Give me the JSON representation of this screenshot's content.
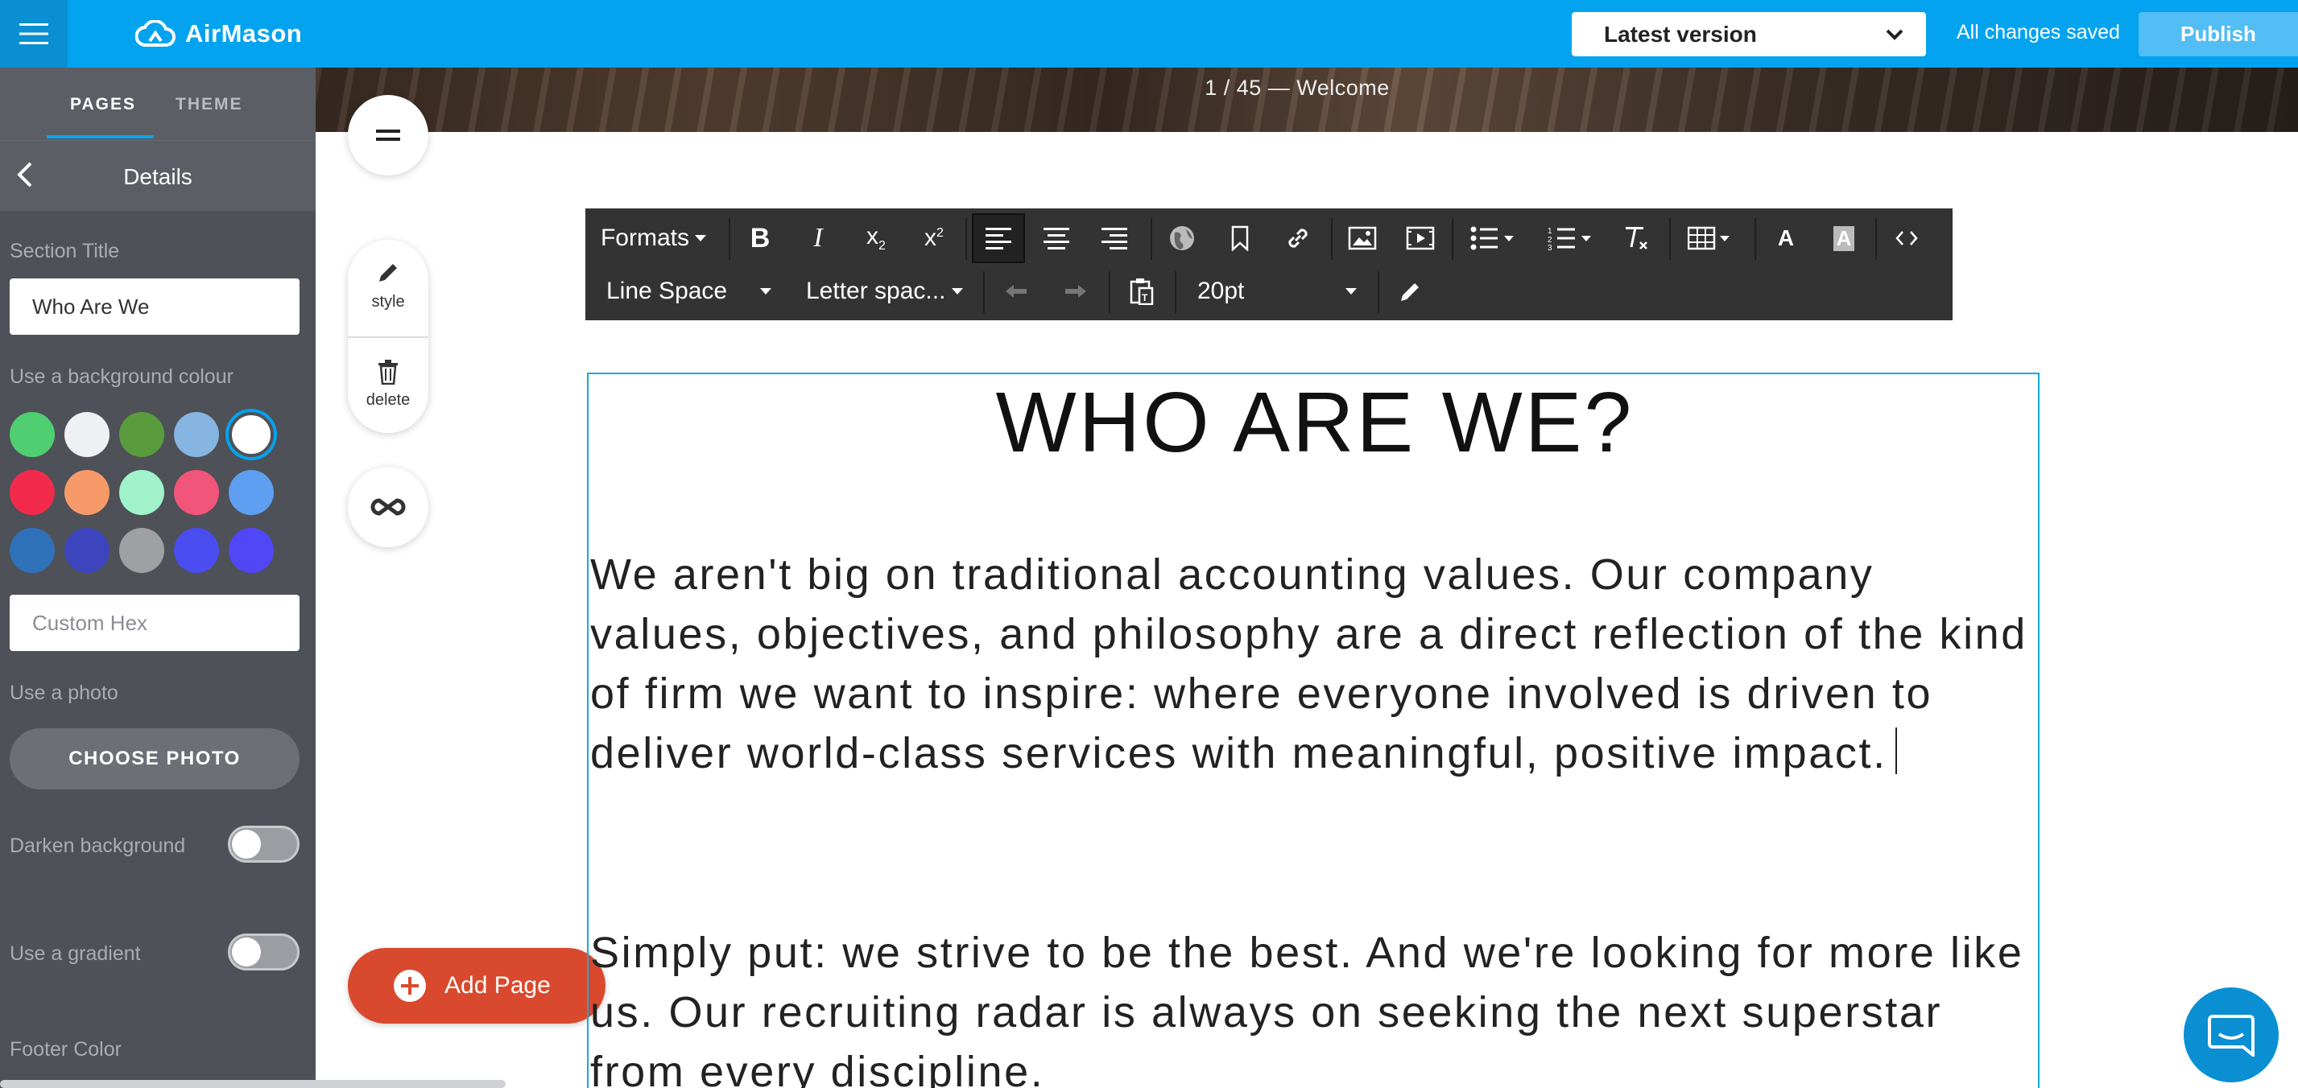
{
  "app": {
    "brand": "AirMason"
  },
  "header": {
    "version_label": "Latest version",
    "status": "All changes saved",
    "publish_label": "Publish"
  },
  "sidebar": {
    "tabs": [
      "PAGES",
      "THEME"
    ],
    "section_header": "Details",
    "section_title_label": "Section Title",
    "section_title_value": "Who Are We",
    "bg_colour_label": "Use a background colour",
    "swatches": [
      "#4fcf72",
      "#eef0f4",
      "#5a9c3d",
      "#86b5e2",
      "#ffffff",
      "#f22b4d",
      "#f79a6a",
      "#9ff2c9",
      "#f2557a",
      "#5f9ff2",
      "#2f72b9",
      "#3c45be",
      "#9ea0a3",
      "#4a4df0",
      "#5047f7"
    ],
    "selected_swatch_index": 4,
    "custom_hex_placeholder": "Custom Hex",
    "photo_label": "Use a photo",
    "choose_photo": "CHOOSE PHOTO",
    "darken_label": "Darken background",
    "darken_on": false,
    "gradient_label": "Use a gradient",
    "gradient_on": false,
    "footer_color_label": "Footer Color"
  },
  "hero": {
    "page_indicator": "1 / 45 — Welcome"
  },
  "tools": {
    "style_label": "style",
    "delete_label": "delete",
    "add_page_label": "Add Page"
  },
  "toolbar": {
    "formats": "Formats",
    "line_space": "Line Space",
    "letter_spacing": "Letter spac...",
    "font_size": "20pt"
  },
  "content": {
    "heading": "WHO ARE WE?",
    "paragraph1": "We aren't big on traditional accounting values. Our company values, objectives, and philosophy are a direct reflection of the kind of firm we want to inspire: where everyone involved is driven to deliver world-class services with meaningful, positive impact.",
    "paragraph2": "Simply put: we strive to be the best. And we're looking for more like us. Our recruiting radar is always on seeking the next superstar from every discipline."
  }
}
